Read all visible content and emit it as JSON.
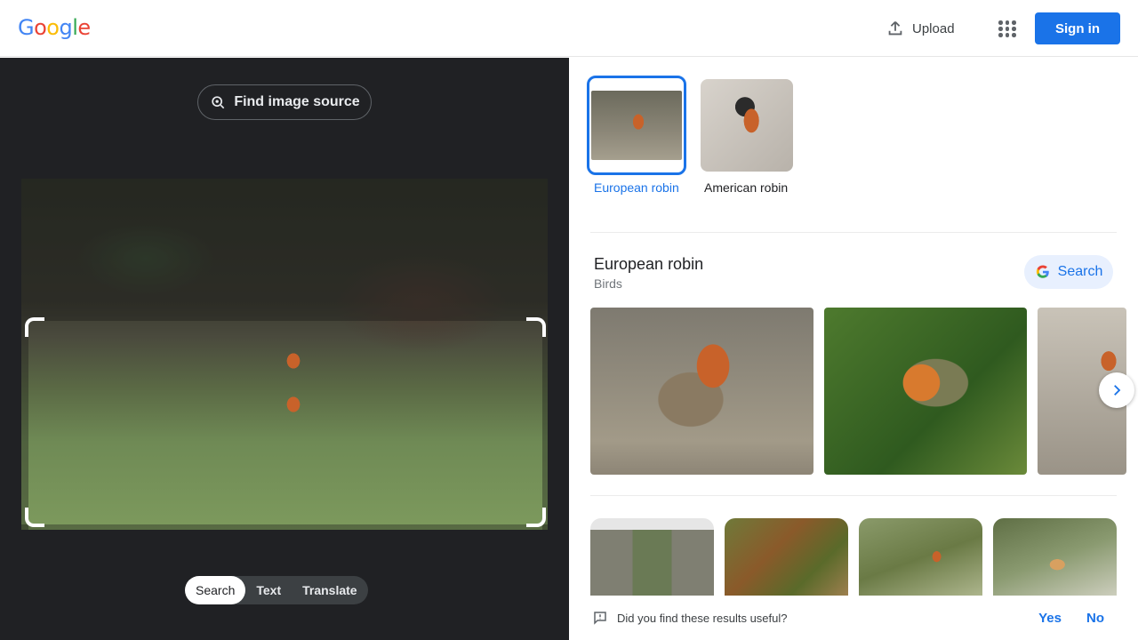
{
  "header": {
    "logo_letters": [
      {
        "ch": "G",
        "color": "#4285f4"
      },
      {
        "ch": "o",
        "color": "#ea4335"
      },
      {
        "ch": "o",
        "color": "#fbbc05"
      },
      {
        "ch": "g",
        "color": "#4285f4"
      },
      {
        "ch": "l",
        "color": "#34a853"
      },
      {
        "ch": "e",
        "color": "#ea4335"
      }
    ],
    "upload_label": "Upload",
    "upload_icon": "upload-icon",
    "apps_icon": "apps-grid-icon",
    "signin_label": "Sign in",
    "accent": "#1a73e8"
  },
  "left": {
    "find_source_label": "Find image source",
    "find_source_icon": "lens-search-icon",
    "modes": [
      "Search",
      "Text",
      "Translate"
    ],
    "active_mode": "Search"
  },
  "right": {
    "matches": [
      {
        "label": "European robin",
        "selected": true
      },
      {
        "label": "American robin",
        "selected": false
      }
    ],
    "entity": {
      "title": "European robin",
      "subtitle": "Birds",
      "search_label": "Search"
    },
    "feedback": {
      "question": "Did you find these results useful?",
      "yes": "Yes",
      "no": "No"
    }
  }
}
